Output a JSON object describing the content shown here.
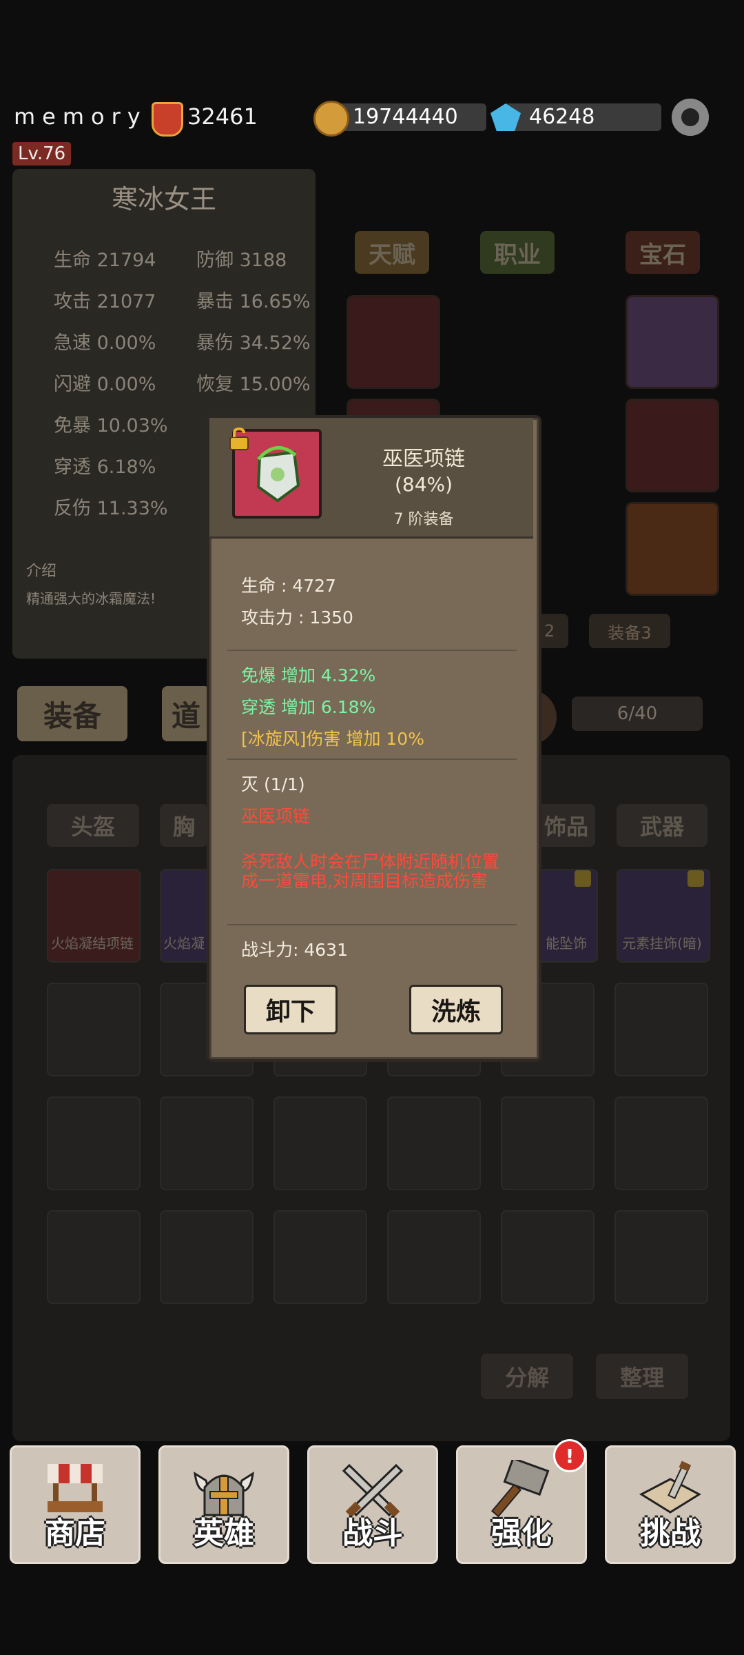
{
  "player": {
    "name": "memory",
    "power": "32461",
    "level": "Lv.76"
  },
  "resources": {
    "gold": "19744440",
    "gems": "46248"
  },
  "hero": {
    "name": "寒冰女王",
    "stats_left": [
      "生命 21794",
      "攻击 21077",
      "急速 0.00%",
      "闪避 0.00%",
      "免暴 10.03%",
      "穿透 6.18%",
      "反伤 11.33%"
    ],
    "stats_right": [
      "防御 3188",
      "暴击 16.65%",
      "暴伤 34.52%",
      "恢复 15.00%"
    ],
    "intro_label": "介绍",
    "intro_text": "精通强大的冰霜魔法!"
  },
  "hero_buttons": {
    "talent": "天赋",
    "class": "职业",
    "gem": "宝石"
  },
  "equip_sets": {
    "set3": "装备3"
  },
  "tabs": {
    "equipment": "装备",
    "items": "道"
  },
  "bag": {
    "count": "6/40"
  },
  "categories": [
    "头盔",
    "胸",
    "饰品",
    "武器"
  ],
  "grid_items": [
    {
      "label": "火焰凝结项链"
    },
    {
      "label": "火焰凝"
    },
    {
      "label": "能坠饰"
    },
    {
      "label": "元素挂饰(暗)"
    }
  ],
  "grid_buttons": {
    "decompose": "分解",
    "sort": "整理"
  },
  "popup": {
    "title": "巫医项链",
    "percent": "(84%)",
    "tier": "7 阶装备",
    "base_stats": [
      "生命 : 4727",
      "攻击力 : 1350"
    ],
    "bonus_stats": [
      "免爆 增加 4.32%",
      "穿透 增加 6.18%"
    ],
    "skill_bonus": "[冰旋风]伤害 增加 10%",
    "set_name": "灭 (1/1)",
    "set_piece": "巫医项链",
    "set_effect": "杀死敌人时会在尸体附近随机位置成一道雷电,对周围目标造成伤害",
    "combat_power": "战斗力: 4631",
    "unequip_label": "卸下",
    "refine_label": "洗炼"
  },
  "nav": [
    {
      "label": "商店",
      "icon": "shop-stall-icon"
    },
    {
      "label": "英雄",
      "icon": "viking-helmet-icon"
    },
    {
      "label": "战斗",
      "icon": "crossed-swords-icon"
    },
    {
      "label": "强化",
      "icon": "hammer-icon",
      "badge": "!"
    },
    {
      "label": "挑战",
      "icon": "map-sword-icon"
    }
  ],
  "colors": {
    "popup_bg": "#786a56",
    "green_stat": "#7df3a6",
    "yellow_stat": "#f1c24a",
    "red_text": "#ff4a3a"
  }
}
